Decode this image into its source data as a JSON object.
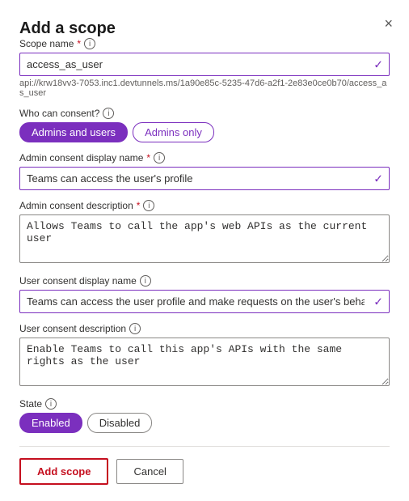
{
  "dialog": {
    "title": "Add a scope",
    "close_label": "×"
  },
  "scope_name": {
    "label": "Scope name",
    "required": "*",
    "info": "i",
    "value": "access_as_user",
    "url": "api://krw18vv3-7053.inc1.devtunnels.ms/1a90e85c-5235-47d6-a2f1-2e83e0ce0b70/access_as_user"
  },
  "who_can_consent": {
    "label": "Who can consent?",
    "info": "i",
    "options": [
      {
        "label": "Admins and users",
        "active": true
      },
      {
        "label": "Admins only",
        "active": false
      }
    ]
  },
  "admin_display_name": {
    "label": "Admin consent display name",
    "required": "*",
    "info": "i",
    "value": "Teams can access the user's profile"
  },
  "admin_description": {
    "label": "Admin consent description",
    "required": "*",
    "info": "i",
    "value": "Allows Teams to call the app's web APIs as the current user"
  },
  "user_display_name": {
    "label": "User consent display name",
    "info": "i",
    "value": "Teams can access the user profile and make requests on the user's behalf"
  },
  "user_description": {
    "label": "User consent description",
    "info": "i",
    "value": "Enable Teams to call this app's APIs with the same rights as the user"
  },
  "state": {
    "label": "State",
    "info": "i",
    "options": [
      {
        "label": "Enabled",
        "active": true
      },
      {
        "label": "Disabled",
        "active": false
      }
    ]
  },
  "actions": {
    "add_scope": "Add scope",
    "cancel": "Cancel"
  }
}
